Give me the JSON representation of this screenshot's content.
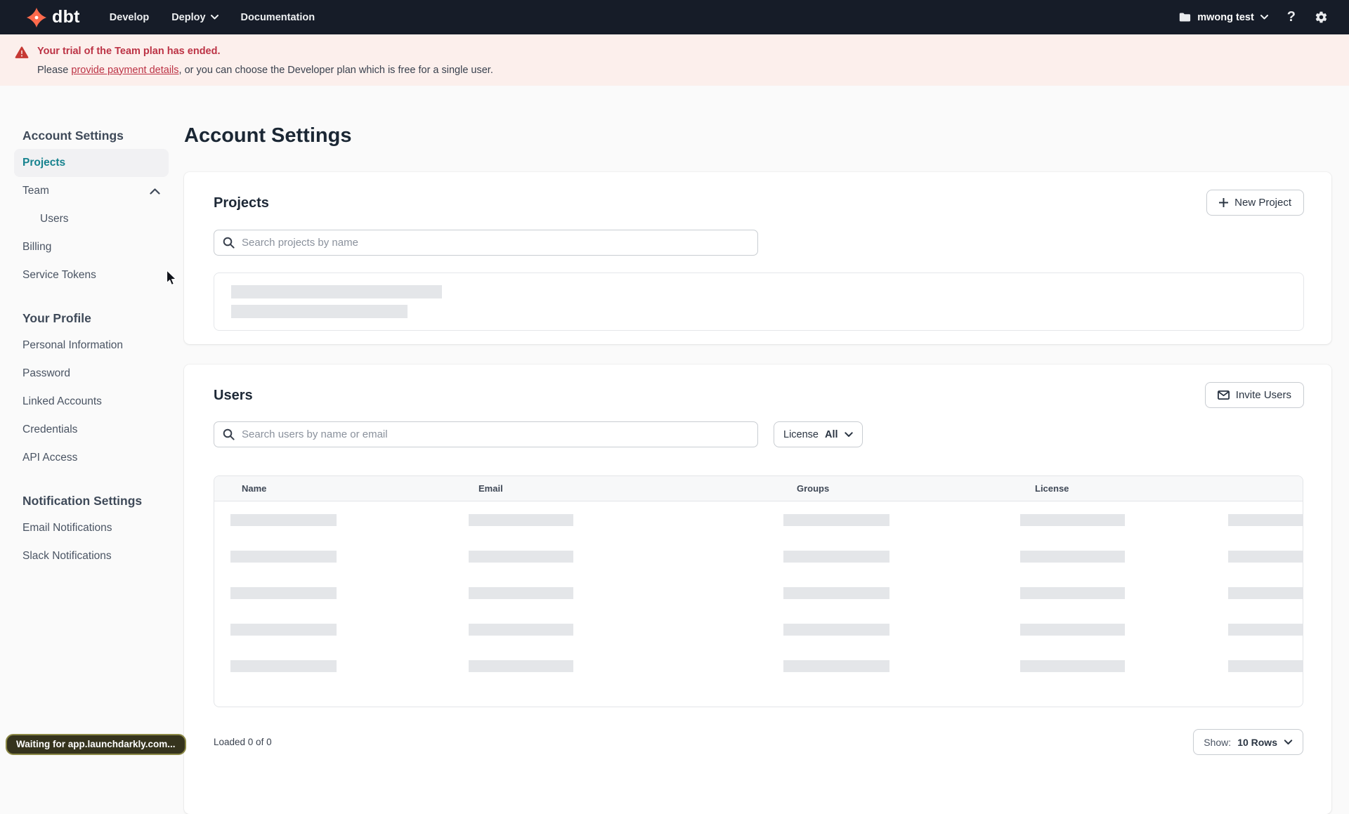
{
  "colors": {
    "navbar_bg": "#161c28",
    "brand_orange": "#ff6a4c",
    "accent_teal": "#16828e",
    "banner_bg": "#fcefec",
    "banner_red": "#bc3345",
    "skeleton_gray": "#e4e6e9"
  },
  "navbar": {
    "logo_text": "dbt",
    "menu": [
      {
        "label": "Develop",
        "has_caret": false
      },
      {
        "label": "Deploy",
        "has_caret": true
      },
      {
        "label": "Documentation",
        "has_caret": false
      }
    ],
    "account": {
      "name": "mwong test",
      "icon": "folder-icon"
    },
    "help_glyph": "?"
  },
  "banner": {
    "icon": "warning-triangle-icon",
    "title": "Your trial of the Team plan has ended.",
    "body_prefix": "Please ",
    "link_text": "provide payment details",
    "body_suffix": ", or you can choose the Developer plan which is free for a single user."
  },
  "sidebar": {
    "groups": [
      {
        "title": "Account Settings",
        "items": [
          {
            "label": "Projects",
            "active": true
          },
          {
            "label": "Team",
            "expanded": true
          },
          {
            "label": "Users",
            "indent": true
          },
          {
            "label": "Billing"
          },
          {
            "label": "Service Tokens"
          }
        ]
      },
      {
        "title": "Your Profile",
        "items": [
          {
            "label": "Personal Information"
          },
          {
            "label": "Password"
          },
          {
            "label": "Linked Accounts"
          },
          {
            "label": "Credentials"
          },
          {
            "label": "API Access"
          }
        ]
      },
      {
        "title": "Notification Settings",
        "items": [
          {
            "label": "Email Notifications"
          },
          {
            "label": "Slack Notifications"
          }
        ]
      }
    ]
  },
  "main": {
    "page_title": "Account Settings",
    "projects": {
      "title": "Projects",
      "new_button": "New Project",
      "search_placeholder": "Search projects by name",
      "loading": true
    },
    "users": {
      "title": "Users",
      "invite_button": "Invite Users",
      "search_placeholder": "Search users by name or email",
      "license_filter": {
        "label": "License",
        "value": "All"
      },
      "table": {
        "columns": [
          "Name",
          "Email",
          "Groups",
          "License"
        ],
        "loading_rows": 5
      },
      "footer": {
        "loaded": "Loaded 0 of 0",
        "show_label": "Show:",
        "show_value": "10 Rows"
      }
    }
  },
  "status_bubble": "Waiting for app.launchdarkly.com..."
}
